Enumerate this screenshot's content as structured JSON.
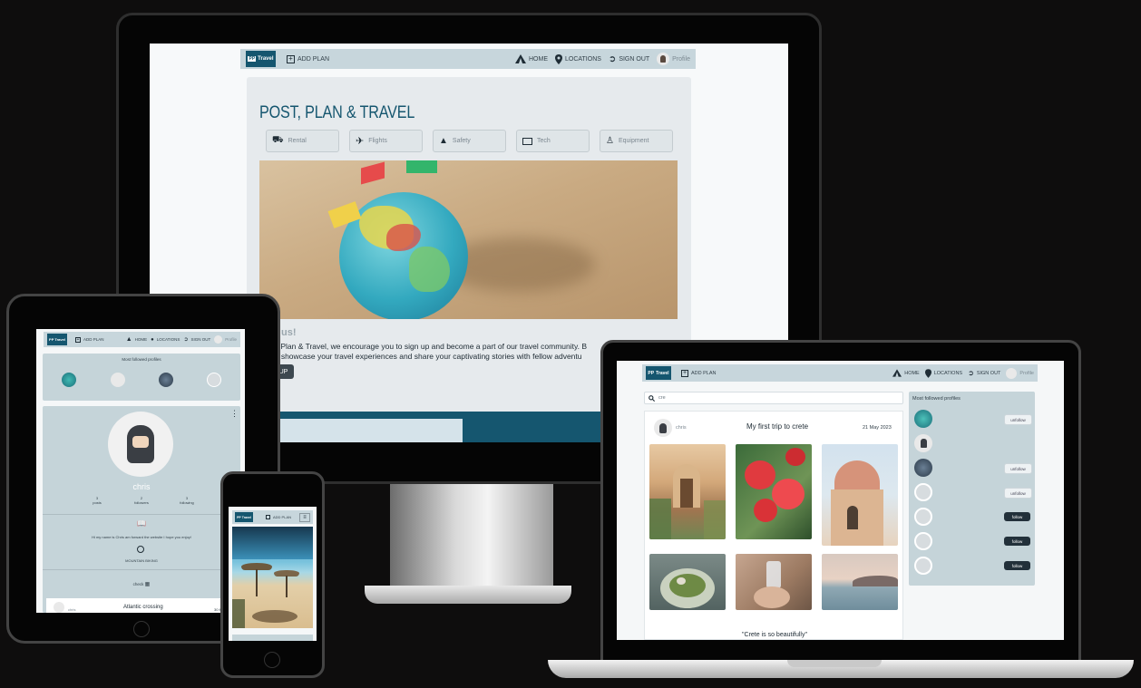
{
  "colors": {
    "page_bg": "#0e0d0d",
    "nav_bg": "#c7d6dc",
    "brand": "#15566f",
    "panel": "#c5d4d9",
    "dark_button": "#22303a"
  },
  "brand": {
    "logo_text": "PP",
    "logo_word": "Travel"
  },
  "nav": {
    "add_plan": "ADD PLAN",
    "home": "HOME",
    "locations": "LOCATIONS",
    "sign_out": "SIGN OUT",
    "profile": "Profile"
  },
  "monitor": {
    "hero_title": "POST, PLAN & TRAVEL",
    "categories": [
      {
        "label": "Rental",
        "icon": "car-icon"
      },
      {
        "label": "Flights",
        "icon": "plane-icon"
      },
      {
        "label": "Safety",
        "icon": "bell-icon"
      },
      {
        "label": "Tech",
        "icon": "laptop-icon"
      },
      {
        "label": "Equipment",
        "icon": "hiker-icon"
      }
    ],
    "join_heading": "us!",
    "intro_line1": "st, Plan & Travel, we encourage you to sign up and become a part of our travel community. B",
    "intro_line2": "an showcase your travel experiences and share your captivating stories with fellow adventu",
    "signup_button": "UP"
  },
  "tablet": {
    "most_followed_title": "Most followed profiles",
    "profile_name": "chris",
    "stats": [
      {
        "count": "3",
        "label": "posts"
      },
      {
        "count": "2",
        "label": "followers"
      },
      {
        "count": "3",
        "label": "following"
      }
    ],
    "bio": "Hi my name is Chris am forward the website I hope you enjoy!",
    "interest": "MOUNTAIN BIKING",
    "checks_label": "check",
    "post_author": "chris",
    "post_title": "Atlantic crossing",
    "post_date": "30 M"
  },
  "laptop": {
    "search_value": "cre",
    "post_author": "chris",
    "post_title": "My first trip to crete",
    "post_date": "21 May 2023",
    "post_caption": "\"Crete is so beautifully\"",
    "most_followed_title": "Most followed profiles",
    "profiles": [
      {
        "button": "unfollow"
      },
      {
        "button": ""
      },
      {
        "button": "unfollow"
      },
      {
        "button": "unfollow"
      },
      {
        "button": "follow"
      },
      {
        "button": "follow"
      },
      {
        "button": "follow"
      }
    ]
  }
}
